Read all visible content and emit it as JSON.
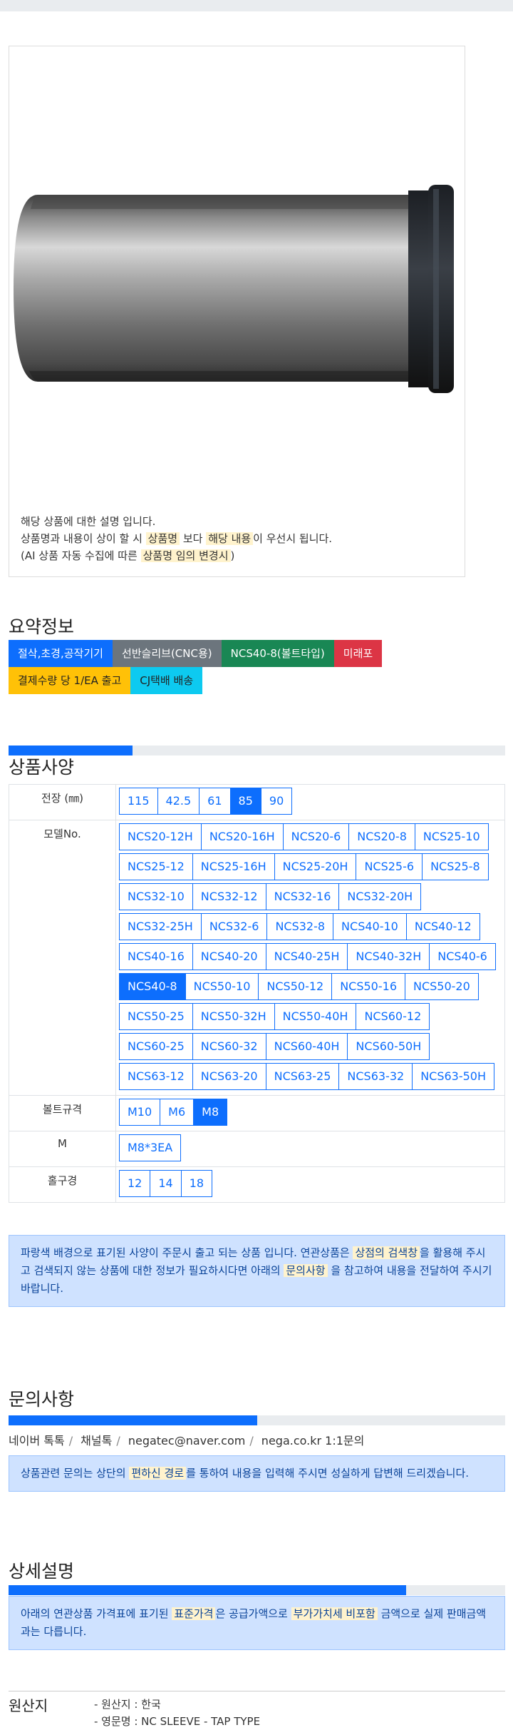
{
  "product": {
    "desc_line1": "해당 상품에 대한 설명 입니다.",
    "desc_line2_a": "상품명과 내용이 상이 할 시 ",
    "desc_line2_hl1": "상품명",
    "desc_line2_b": " 보다 ",
    "desc_line2_hl2": "해당 내용",
    "desc_line2_c": "이 우선시 됩니다.",
    "desc_line3_a": "(AI 상품 자동 수집에 따른 ",
    "desc_line3_hl": "상품명 임의 변경시",
    "desc_line3_b": ")"
  },
  "summary": {
    "title": "요약정보",
    "badges": [
      "절삭,초경,공작기기",
      "선반슬리브(CNC용)",
      "NCS40-8(볼트타입)",
      "미래포",
      "결제수량 당 1/EA 출고",
      "CJ택배 배송"
    ]
  },
  "spec": {
    "title": "상품사양",
    "progress_percent": 25,
    "rows": [
      {
        "label": "전장 (㎜)",
        "options": [
          "115",
          "42.5",
          "61",
          "85",
          "90"
        ],
        "selected": "85"
      },
      {
        "label": "모델No.",
        "options": [
          "NCS20-12H",
          "NCS20-16H",
          "NCS20-6",
          "NCS20-8",
          "NCS25-10",
          "NCS25-12",
          "NCS25-16H",
          "NCS25-20H",
          "NCS25-6",
          "NCS25-8",
          "NCS32-10",
          "NCS32-12",
          "NCS32-16",
          "NCS32-20H",
          "NCS32-25H",
          "NCS32-6",
          "NCS32-8",
          "NCS40-10",
          "NCS40-12",
          "NCS40-16",
          "NCS40-20",
          "NCS40-25H",
          "NCS40-32H",
          "NCS40-6",
          "NCS40-8",
          "NCS50-10",
          "NCS50-12",
          "NCS50-16",
          "NCS50-20",
          "NCS50-25",
          "NCS50-32H",
          "NCS50-40H",
          "NCS60-12",
          "NCS60-25",
          "NCS60-32",
          "NCS60-40H",
          "NCS60-50H",
          "NCS63-12",
          "NCS63-20",
          "NCS63-25",
          "NCS63-32",
          "NCS63-50H"
        ],
        "selected": "NCS40-8"
      },
      {
        "label": "볼트규격",
        "options": [
          "M10",
          "M6",
          "M8"
        ],
        "selected": "M8"
      },
      {
        "label": "M",
        "options": [
          "M8*3EA"
        ],
        "selected": ""
      },
      {
        "label": "홀구경",
        "options": [
          "12",
          "14",
          "18"
        ],
        "selected": ""
      }
    ],
    "notice_a": "파랑색 배경으로 표기된 사양이 주문시 출고 되는 상품 입니다. 연관상품은 ",
    "notice_hl1": "상점의 검색창",
    "notice_b": "을 활용해 주시고 검색되지 않는 상품에 대한 정보가 필요하시다면 아래의 ",
    "notice_hl2": "문의사항",
    "notice_c": " 을 참고하여 내용을 전달하여 주시기 바랍니다."
  },
  "inquiry": {
    "title": "문의사항",
    "progress_percent": 50,
    "contacts": [
      "네이버 톡톡",
      "채널톡",
      "negatec@naver.com",
      "nega.co.kr 1:1문의"
    ],
    "notice_a": "상품관련 문의는 상단의 ",
    "notice_hl": "편하신 경로",
    "notice_b": "를 통하여 내용을 입력해 주시면 성실하게 답변해 드리겠습니다."
  },
  "detail": {
    "title": "상세설명",
    "progress_percent": 80,
    "notice_a": "아래의 연관상품 가격표에 표기된 ",
    "notice_hl1": "표준가격",
    "notice_b": "은 공급가액으로 ",
    "notice_hl2": "부가가치세 비포함",
    "notice_c": " 금액으로 실제 판매금액과는 다릅니다."
  },
  "origin": {
    "title": "원산지",
    "items": [
      "- 원산지 : 한국",
      "- 영문명 : NC SLEEVE - TAP TYPE"
    ]
  }
}
